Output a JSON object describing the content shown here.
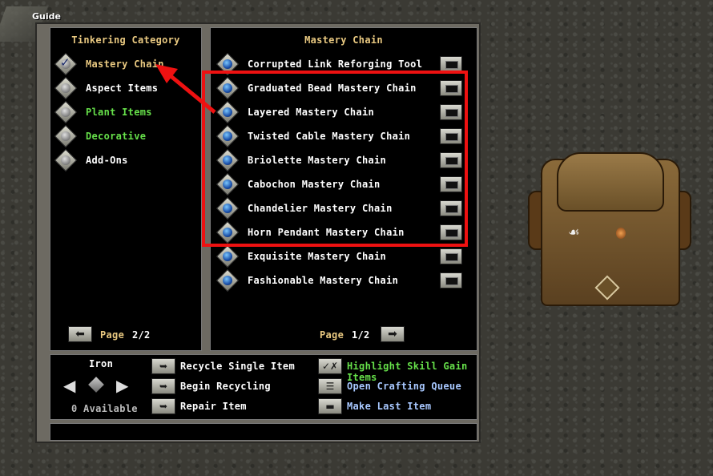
{
  "guide": {
    "label": "Guide"
  },
  "categories": {
    "title": "Tinkering Category",
    "items": [
      {
        "label": "Mastery Chain",
        "color": "gold",
        "checked": true
      },
      {
        "label": "Aspect Items",
        "color": "white"
      },
      {
        "label": "Plant Items",
        "color": "green"
      },
      {
        "label": "Decorative",
        "color": "green"
      },
      {
        "label": "Add-Ons",
        "color": "white"
      }
    ],
    "page_label": "Page",
    "page_value": "2/2"
  },
  "recipes": {
    "title": "Mastery Chain",
    "items": [
      "Corrupted Link Reforging Tool",
      "Graduated Bead Mastery Chain",
      "Layered Mastery Chain",
      "Twisted Cable Mastery Chain",
      "Briolette Mastery Chain",
      "Cabochon Mastery Chain",
      "Chandelier Mastery Chain",
      "Horn Pendant Mastery Chain",
      "Exquisite Mastery Chain",
      "Fashionable Mastery Chain"
    ],
    "page_label": "Page",
    "page_value": "1/2"
  },
  "material": {
    "name": "Iron",
    "available": "0 Available"
  },
  "actions": {
    "recycle_single": "Recycle Single Item",
    "begin_recycling": "Begin Recycling",
    "repair_item": "Repair Item",
    "highlight_skill": "Highlight Skill Gain Items",
    "open_queue": "Open Crafting Queue",
    "make_last": "Make Last Item"
  },
  "colors": {
    "highlight_box": "#ee1111",
    "gold": "#e8c880",
    "green": "#66e04a",
    "blue": "#a8c8ff"
  }
}
